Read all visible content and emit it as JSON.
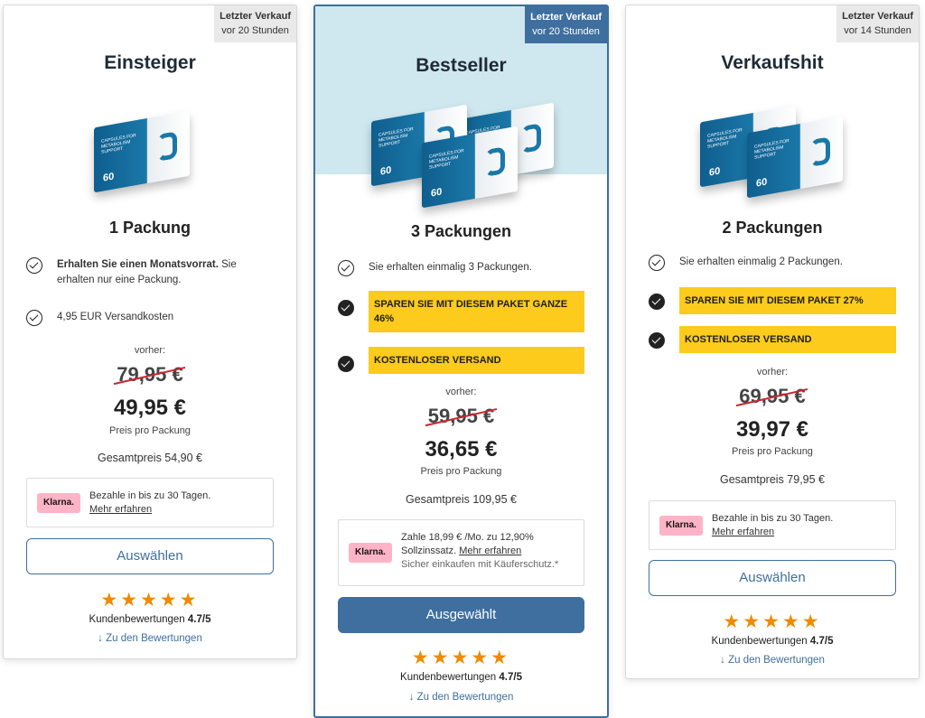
{
  "cards": [
    {
      "badge_title": "Letzter Verkauf",
      "badge_time": "vor 20 Stunden",
      "title": "Einsteiger",
      "pack_title": "1 Packung",
      "feature1_bold": "Erhalten Sie einen Monatsvorrat.",
      "feature1_rest": " Sie erhalten nur eine Packung.",
      "feature2": "4,95 EUR Versandkosten",
      "before_label": "vorher:",
      "old_price": "79,95 €",
      "new_price": "49,95 €",
      "per_pack": "Preis pro Packung",
      "total": "Gesamtpreis 54,90 €",
      "klarna_logo": "Klarna.",
      "klarna_line1": "Bezahle in bis zu 30 Tagen.",
      "klarna_link": "Mehr erfahren",
      "button": "Auswählen",
      "reviews_label": "Kundenbewertungen",
      "rating": "4.7/5",
      "review_link": "↓ Zu den Bewertungen"
    },
    {
      "badge_title": "Letzter Verkauf",
      "badge_time": "vor 20 Stunden",
      "title": "Bestseller",
      "pack_title": "3 Packungen",
      "feature1": "Sie erhalten einmalig 3 Packungen.",
      "feature2": "SPAREN SIE MIT DIESEM PAKET GANZE 46%",
      "feature3": "KOSTENLOSER VERSAND",
      "before_label": "vorher:",
      "old_price": "59,95 €",
      "new_price": "36,65 €",
      "per_pack": "Preis pro Packung",
      "total": "Gesamtpreis 109,95 €",
      "klarna_logo": "Klarna.",
      "klarna_line1": "Zahle 18,99 € /Mo. zu 12,90% Sollzinssatz.",
      "klarna_link": "Mehr erfahren",
      "klarna_sub": "Sicher einkaufen mit Käuferschutz.*",
      "button": "Ausgewählt",
      "reviews_label": "Kundenbewertungen",
      "rating": "4.7/5",
      "review_link": "↓ Zu den Bewertungen"
    },
    {
      "badge_title": "Letzter Verkauf",
      "badge_time": "vor 14 Stunden",
      "title": "Verkaufshit",
      "pack_title": "2 Packungen",
      "feature1": "Sie erhalten einmalig 2 Packungen.",
      "feature2": "SPAREN SIE MIT DIESEM PAKET 27%",
      "feature3": "KOSTENLOSER VERSAND",
      "before_label": "vorher:",
      "old_price": "69,95 €",
      "new_price": "39,97 €",
      "per_pack": "Preis pro Packung",
      "total": "Gesamtpreis 79,95 €",
      "klarna_logo": "Klarna.",
      "klarna_line1": "Bezahle in bis zu 30 Tagen.",
      "klarna_link": "Mehr erfahren",
      "button": "Auswählen",
      "reviews_label": "Kundenbewertungen",
      "rating": "4.7/5",
      "review_link": "↓ Zu den Bewertungen"
    }
  ],
  "product": {
    "box_text": "CAPSULES FOR METABOLISM SUPPORT",
    "box_count": "60"
  },
  "stars": "★★★★★",
  "colors": {
    "accent": "#3e6f9e",
    "highlight": "#fccb1b",
    "star": "#f08a00",
    "klarna": "#ffb3c7",
    "strike": "#c8282e"
  },
  "icons": {
    "check": "check-circle-icon",
    "arrow": "arrow-down-icon",
    "star": "star-icon"
  }
}
